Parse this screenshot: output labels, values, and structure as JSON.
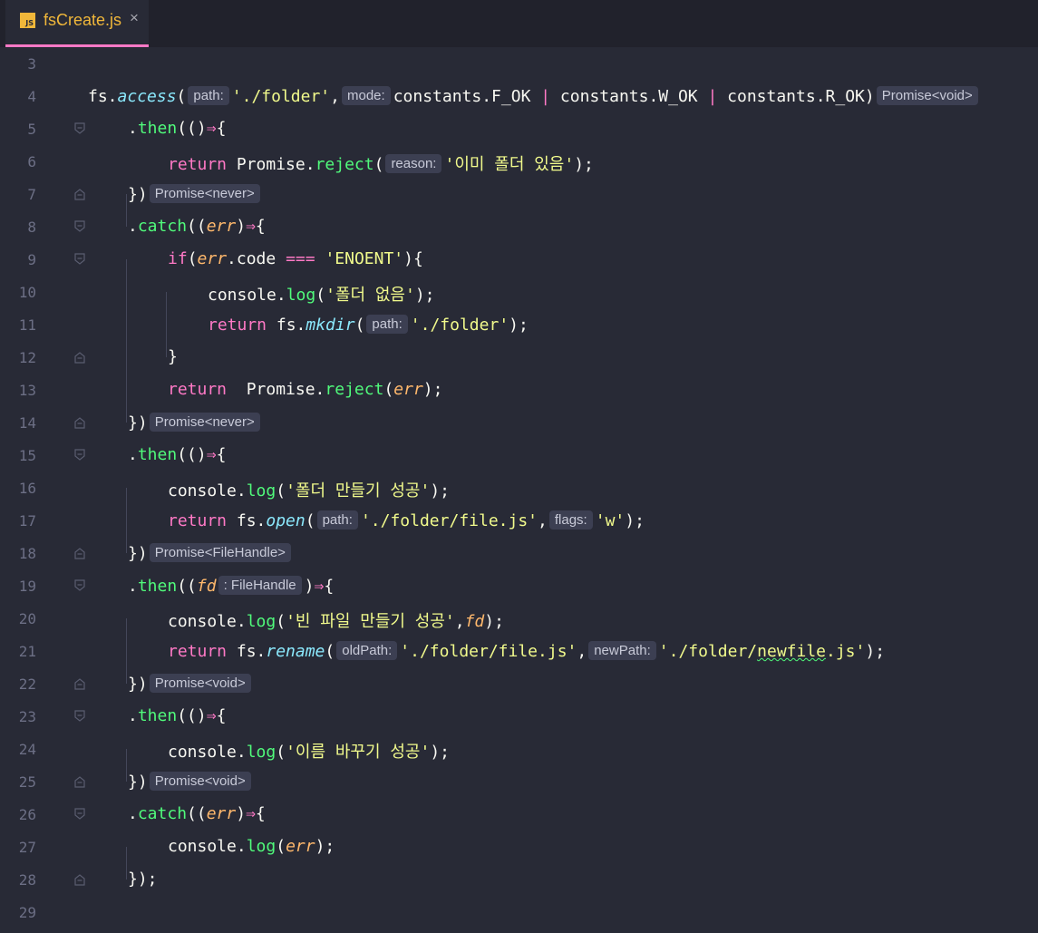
{
  "tab": {
    "icon_text": "JS",
    "filename": "fsCreate.js",
    "close": "×"
  },
  "line_numbers": [
    "3",
    "4",
    "5",
    "6",
    "7",
    "8",
    "9",
    "10",
    "11",
    "12",
    "13",
    "14",
    "15",
    "16",
    "17",
    "18",
    "19",
    "20",
    "21",
    "22",
    "23",
    "24",
    "25",
    "26",
    "27",
    "28",
    "29"
  ],
  "code": {
    "l4": {
      "a": "fs.",
      "b": "access",
      "c": "(",
      "h1": "path:",
      "d": "'./folder'",
      "e": ",",
      "h2": "mode:",
      "f": "constants.F_OK ",
      "g": "|",
      "i": " constants.W_OK ",
      "j": "|",
      "k": " constants.R_OK)",
      "h3": "Promise<void>"
    },
    "l5": {
      "a": ".",
      "b": "then",
      "c": "(()",
      "d": "⇒",
      "e": "{"
    },
    "l6": {
      "a": "return ",
      "b": "Promise.",
      "c": "reject",
      "d": "(",
      "h1": "reason:",
      "e": "'이미 폴더 있음'",
      "f": ");"
    },
    "l7": {
      "a": "})",
      "h1": "Promise<never>"
    },
    "l8": {
      "a": ".",
      "b": "catch",
      "c": "((",
      "d": "err",
      "e": ")",
      "f": "⇒",
      "g": "{"
    },
    "l9": {
      "a": "if",
      "b": "(",
      "c": "err",
      "d": ".code ",
      "e": "===",
      "f": " ",
      "g": "'ENOENT'",
      "i": "){"
    },
    "l10": {
      "a": "console.",
      "b": "log",
      "c": "(",
      "d": "'폴더 없음'",
      "e": ");"
    },
    "l11": {
      "a": "return ",
      "b": "fs.",
      "c": "mkdir",
      "d": "(",
      "h1": "path:",
      "e": "'./folder'",
      "f": ");"
    },
    "l12": {
      "a": "}"
    },
    "l13": {
      "a": "return ",
      "b": " Promise.",
      "c": "reject",
      "d": "(",
      "e": "err",
      "f": ");"
    },
    "l14": {
      "a": "})",
      "h1": "Promise<never>"
    },
    "l15": {
      "a": ".",
      "b": "then",
      "c": "(()",
      "d": "⇒",
      "e": "{"
    },
    "l16": {
      "a": "console.",
      "b": "log",
      "c": "(",
      "d": "'폴더 만들기 성공'",
      "e": ");"
    },
    "l17": {
      "a": "return ",
      "b": "fs.",
      "c": "open",
      "d": "(",
      "h1": "path:",
      "e": "'./folder/file.js'",
      "f": ",",
      "h2": "flags:",
      "g": "'w'",
      "i": ");"
    },
    "l18": {
      "a": "})",
      "h1": "Promise<FileHandle>"
    },
    "l19": {
      "a": ".",
      "b": "then",
      "c": "((",
      "d": "fd",
      "h1": ": FileHandle",
      "e": ")",
      "f": "⇒",
      "g": "{"
    },
    "l20": {
      "a": "console.",
      "b": "log",
      "c": "(",
      "d": "'빈 파일 만들기 성공'",
      "e": ",",
      "f": "fd",
      "g": ");"
    },
    "l21": {
      "a": "return ",
      "b": "fs.",
      "c": "rename",
      "d": "(",
      "h1": "oldPath:",
      "e": "'./folder/file.js'",
      "f": ",",
      "h2": "newPath:",
      "g": "'./folder/",
      "i": "newfile",
      "j": ".js'",
      "k": ");"
    },
    "l22": {
      "a": "})",
      "h1": "Promise<void>"
    },
    "l23": {
      "a": ".",
      "b": "then",
      "c": "(()",
      "d": "⇒",
      "e": "{"
    },
    "l24": {
      "a": "console.",
      "b": "log",
      "c": "(",
      "d": "'이름 바꾸기 성공'",
      "e": ");"
    },
    "l25": {
      "a": "})",
      "h1": "Promise<void>"
    },
    "l26": {
      "a": ".",
      "b": "catch",
      "c": "((",
      "d": "err",
      "e": ")",
      "f": "⇒",
      "g": "{"
    },
    "l27": {
      "a": "console.",
      "b": "log",
      "c": "(",
      "d": "err",
      "e": ");"
    },
    "l28": {
      "a": "});"
    }
  },
  "colors": {
    "background": "#282a36",
    "keyword": "#ff79c6",
    "function": "#50fa7b",
    "string": "#f1fa8c",
    "parameter": "#ffb86c",
    "tab_accent": "#ff79c6"
  }
}
